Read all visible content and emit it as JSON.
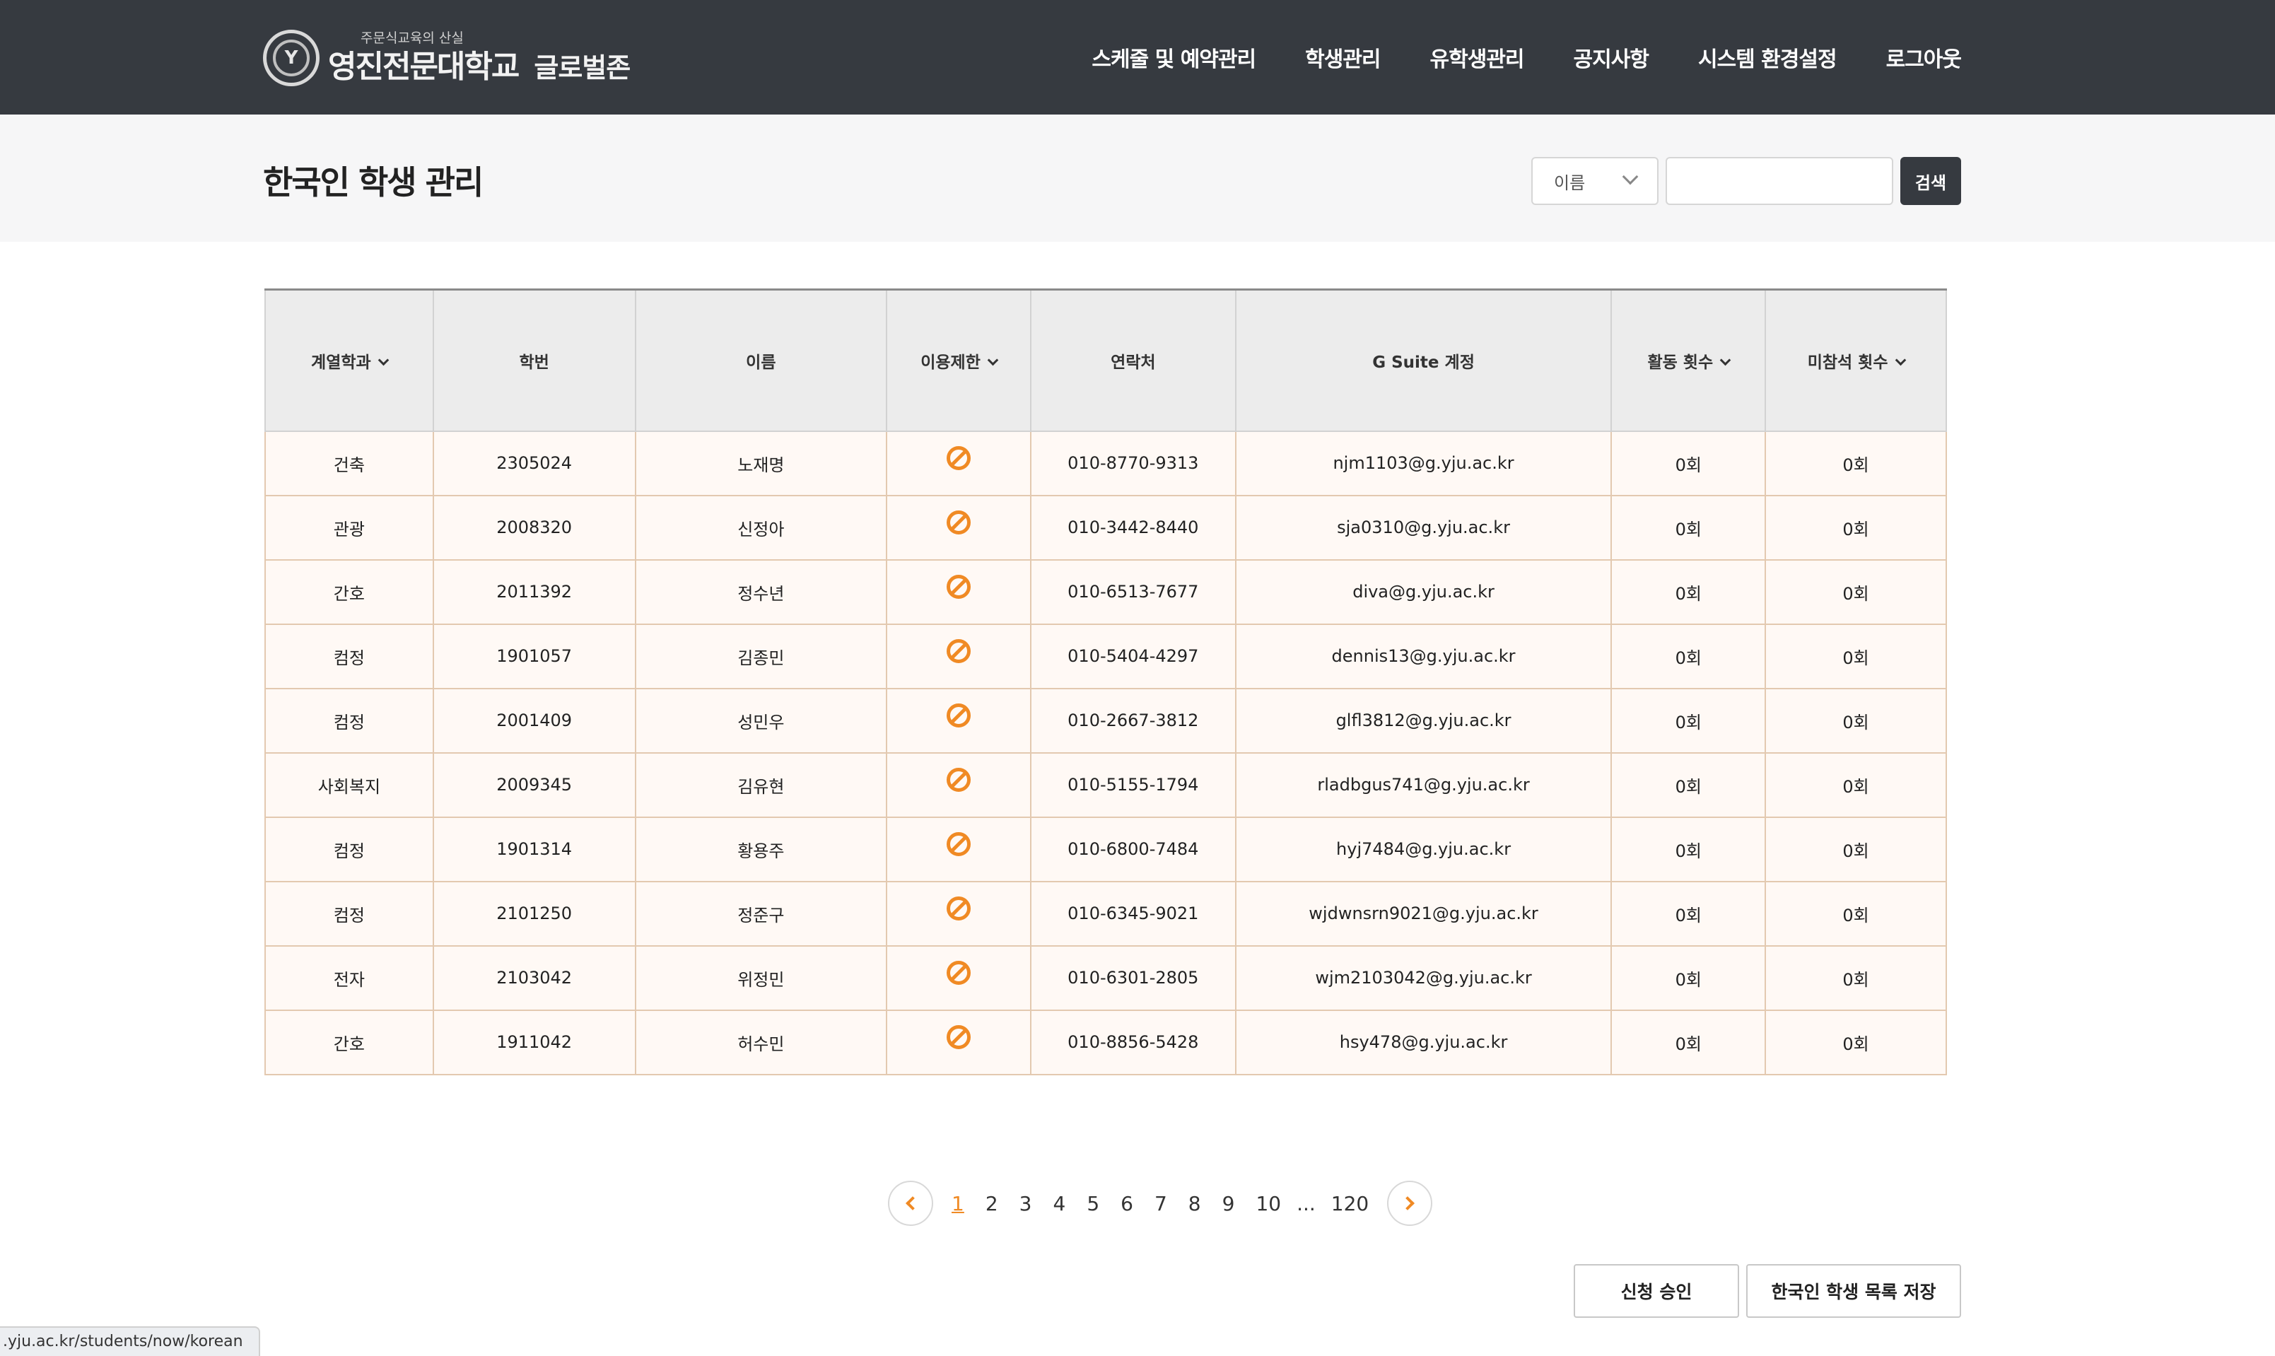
{
  "header": {
    "logo_emblem": "Y",
    "logo_sub": "주문식교육의 산실",
    "logo_main": "영진전문대학교",
    "logo_zone": "글로벌존",
    "nav": [
      {
        "label": "스케줄 및 예약관리"
      },
      {
        "label": "학생관리"
      },
      {
        "label": "유학생관리"
      },
      {
        "label": "공지사항"
      },
      {
        "label": "시스템 환경설정"
      },
      {
        "label": "로그아웃"
      }
    ]
  },
  "page": {
    "title": "한국인 학생 관리"
  },
  "search": {
    "field_selected": "이름",
    "query": "",
    "button_label": "검색"
  },
  "table": {
    "columns": {
      "dept": "계열학과",
      "student_id": "학번",
      "name": "이름",
      "restriction": "이용제한",
      "phone": "연락처",
      "gsuite": "G Suite 계정",
      "activity": "활동 횟수",
      "absence": "미참석 횟수"
    },
    "rows": [
      {
        "dept": "건축",
        "student_id": "2305024",
        "name": "노재명",
        "phone": "010-8770-9313",
        "gsuite": "njm1103@g.yju.ac.kr",
        "activity": "0회",
        "absence": "0회"
      },
      {
        "dept": "관광",
        "student_id": "2008320",
        "name": "신정아",
        "phone": "010-3442-8440",
        "gsuite": "sja0310@g.yju.ac.kr",
        "activity": "0회",
        "absence": "0회"
      },
      {
        "dept": "간호",
        "student_id": "2011392",
        "name": "정수년",
        "phone": "010-6513-7677",
        "gsuite": "diva@g.yju.ac.kr",
        "activity": "0회",
        "absence": "0회"
      },
      {
        "dept": "컴정",
        "student_id": "1901057",
        "name": "김종민",
        "phone": "010-5404-4297",
        "gsuite": "dennis13@g.yju.ac.kr",
        "activity": "0회",
        "absence": "0회"
      },
      {
        "dept": "컴정",
        "student_id": "2001409",
        "name": "성민우",
        "phone": "010-2667-3812",
        "gsuite": "glfl3812@g.yju.ac.kr",
        "activity": "0회",
        "absence": "0회"
      },
      {
        "dept": "사회복지",
        "student_id": "2009345",
        "name": "김유현",
        "phone": "010-5155-1794",
        "gsuite": "rladbgus741@g.yju.ac.kr",
        "activity": "0회",
        "absence": "0회"
      },
      {
        "dept": "컴정",
        "student_id": "1901314",
        "name": "황용주",
        "phone": "010-6800-7484",
        "gsuite": "hyj7484@g.yju.ac.kr",
        "activity": "0회",
        "absence": "0회"
      },
      {
        "dept": "컴정",
        "student_id": "2101250",
        "name": "정준구",
        "phone": "010-6345-9021",
        "gsuite": "wjdwnsrn9021@g.yju.ac.kr",
        "activity": "0회",
        "absence": "0회"
      },
      {
        "dept": "전자",
        "student_id": "2103042",
        "name": "위정민",
        "phone": "010-6301-2805",
        "gsuite": "wjm2103042@g.yju.ac.kr",
        "activity": "0회",
        "absence": "0회"
      },
      {
        "dept": "간호",
        "student_id": "1911042",
        "name": "허수민",
        "phone": "010-8856-5428",
        "gsuite": "hsy478@g.yju.ac.kr",
        "activity": "0회",
        "absence": "0회"
      }
    ]
  },
  "pagination": {
    "pages": [
      "1",
      "2",
      "3",
      "4",
      "5",
      "6",
      "7",
      "8",
      "9",
      "10"
    ],
    "current": "1",
    "ellipsis": "...",
    "last": "120"
  },
  "actions": {
    "approve_label": "신청 승인",
    "save_label": "한국인 학생 목록 저장"
  },
  "status_url": ".yju.ac.kr/students/now/korean",
  "colors": {
    "header_bg": "#363a40",
    "accent": "#f08a24",
    "row_bg": "#fff9f5",
    "row_border": "#e3c9b0",
    "titlebar_bg": "#f6f6f7"
  },
  "icons": {
    "restriction": "ban-icon",
    "sort": "chevron-down-icon",
    "prev": "chevron-left-icon",
    "next": "chevron-right-icon"
  }
}
